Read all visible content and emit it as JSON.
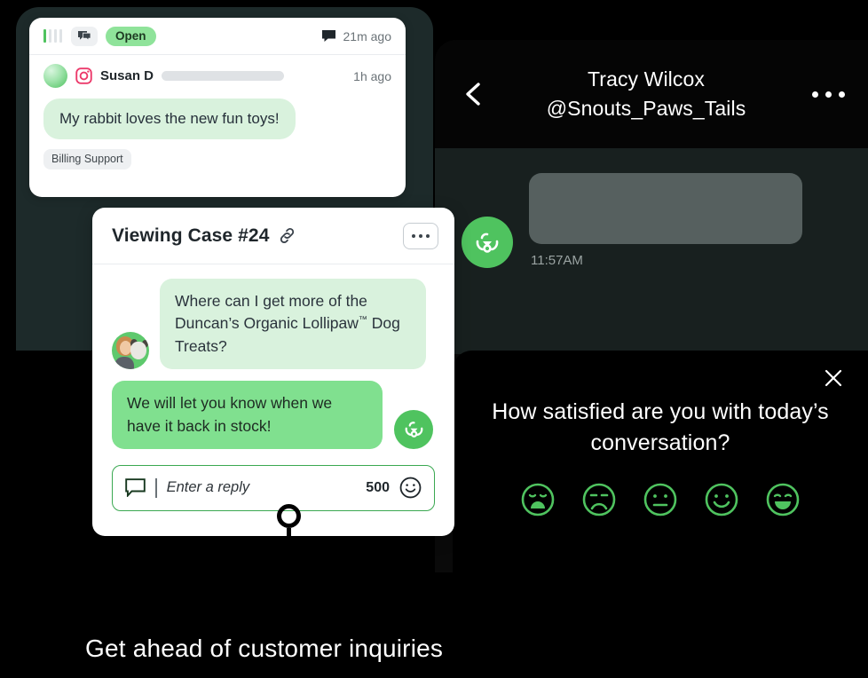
{
  "caption": "Get ahead of customer inquiries",
  "inbox_card": {
    "priority_icon": "signal-bars-icon",
    "priority_level": 1,
    "priority_total": 4,
    "chat_icon": "chat-bubbles-icon",
    "status": "Open",
    "message_icon": "message-icon",
    "updated_ago": "21m ago",
    "channel_icon": "instagram-icon",
    "avatar_icon": "gradient-avatar",
    "sender": "Susan D",
    "sender_ago": "1h ago",
    "message": "My rabbit loves the new fun toys!",
    "tag": "Billing Support"
  },
  "case_card": {
    "title": "Viewing Case #24",
    "link_icon": "link-icon",
    "more_icon": "more-horizontal-icon",
    "messages": [
      {
        "direction": "incoming",
        "avatar": "customer-photo-avatar",
        "text_part1": "Where can I get more of the Duncan’s Organic Lollipaw",
        "trademark": "™",
        "text_part2": " Dog Treats?"
      },
      {
        "direction": "outgoing",
        "avatar": "brand-pet-logo",
        "text": "We will let you know when we have it back in stock!"
      }
    ],
    "reply": {
      "icon": "message-square-icon",
      "placeholder": "Enter a reply",
      "char_count": "500",
      "emoji_icon": "smiley-icon"
    }
  },
  "conversation_panel": {
    "back_icon": "chevron-left-icon",
    "name": "Tracy Wilcox",
    "handle": "@Snouts_Paws_Tails",
    "more_icon": "more-horizontal-icon",
    "agent_avatar_icon": "brand-pet-logo",
    "message_timestamp": "11:57AM"
  },
  "survey": {
    "close_icon": "close-icon",
    "question": "How satisfied are you with today’s conversation?",
    "ratings": [
      {
        "icon": "face-very-dissatisfied-icon",
        "label": "Very dissatisfied"
      },
      {
        "icon": "face-dissatisfied-icon",
        "label": "Dissatisfied"
      },
      {
        "icon": "face-neutral-icon",
        "label": "Neutral"
      },
      {
        "icon": "face-satisfied-icon",
        "label": "Satisfied"
      },
      {
        "icon": "face-very-satisfied-icon",
        "label": "Very satisfied"
      }
    ]
  },
  "pin": {
    "icon": "map-pin-marker"
  },
  "colors": {
    "brand_green": "#4fc35f",
    "bubble_light_green": "#d9f2dd",
    "bubble_green": "#80e08f",
    "status_green": "#8fe39a",
    "panel_dark": "#1d2a2a",
    "panel_black": "#0a0a0a"
  }
}
